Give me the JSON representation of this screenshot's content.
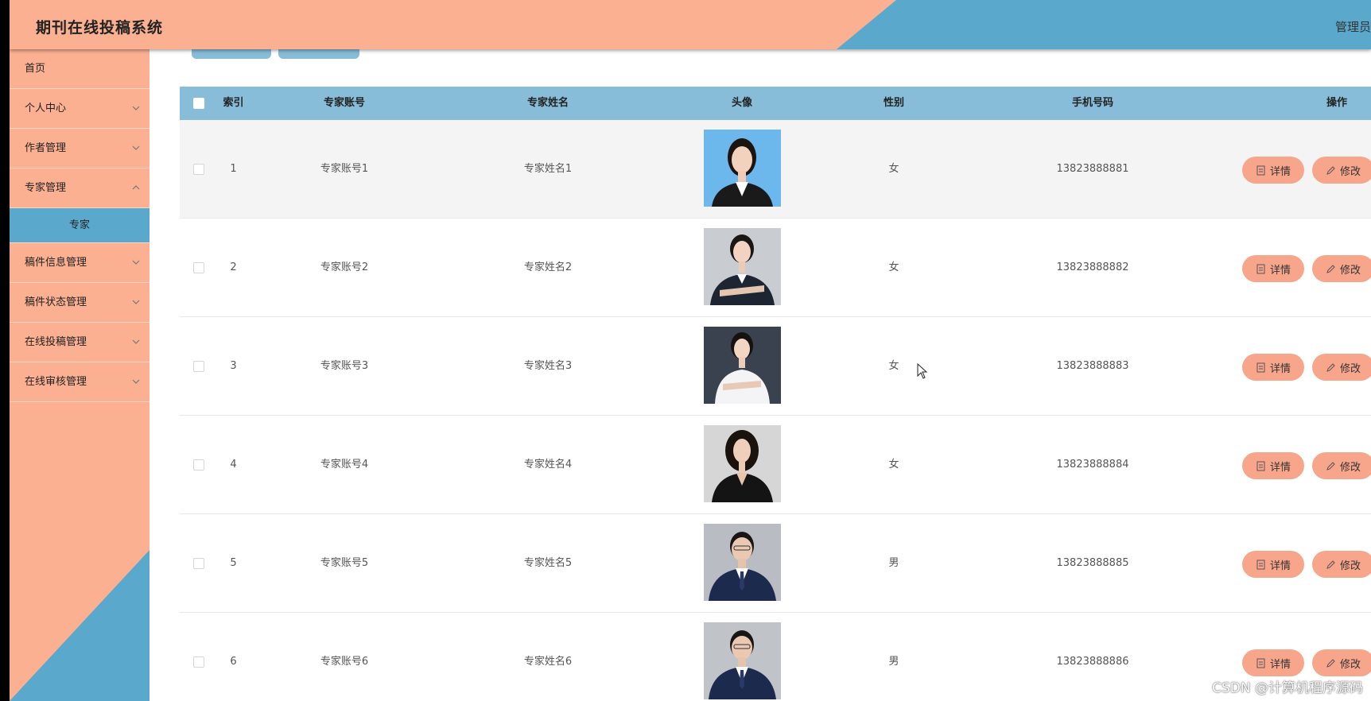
{
  "header": {
    "title": "期刊在线投稿系统",
    "user": "管理员",
    "colors": {
      "salmon": "#fbb092",
      "blue": "#5aa8cc"
    }
  },
  "sidebar": {
    "items": [
      {
        "label": "首页",
        "icon": ""
      },
      {
        "label": "个人中心",
        "icon": "chevron-down-icon"
      },
      {
        "label": "作者管理",
        "icon": "chevron-down-icon"
      },
      {
        "label": "专家管理",
        "icon": "chevron-down-icon"
      },
      {
        "label": "专家",
        "icon": ""
      },
      {
        "label": "稿件信息管理",
        "icon": "chevron-down-icon"
      },
      {
        "label": "稿件状态管理",
        "icon": "chevron-down-icon"
      },
      {
        "label": "在线投稿管理",
        "icon": "chevron-down-icon"
      },
      {
        "label": "在线审核管理",
        "icon": "chevron-down-icon"
      }
    ]
  },
  "table": {
    "headers": [
      "索引",
      "专家账号",
      "专家姓名",
      "头像",
      "性别",
      "手机号码",
      "操作"
    ],
    "detail_label": "详情",
    "edit_label": "修改",
    "rows": [
      {
        "index": "1",
        "account": "专家账号1",
        "name": "专家姓名1",
        "gender": "女",
        "phone": "13823888881"
      },
      {
        "index": "2",
        "account": "专家账号2",
        "name": "专家姓名2",
        "gender": "女",
        "phone": "13823888882"
      },
      {
        "index": "3",
        "account": "专家账号3",
        "name": "专家姓名3",
        "gender": "女",
        "phone": "13823888883"
      },
      {
        "index": "4",
        "account": "专家账号4",
        "name": "专家姓名4",
        "gender": "女",
        "phone": "13823888884"
      },
      {
        "index": "5",
        "account": "专家账号5",
        "name": "专家姓名5",
        "gender": "男",
        "phone": "13823888885"
      },
      {
        "index": "6",
        "account": "专家账号6",
        "name": "专家姓名6",
        "gender": "男",
        "phone": "13823888886"
      }
    ]
  },
  "watermark": "CSDN @计算机程序源码"
}
